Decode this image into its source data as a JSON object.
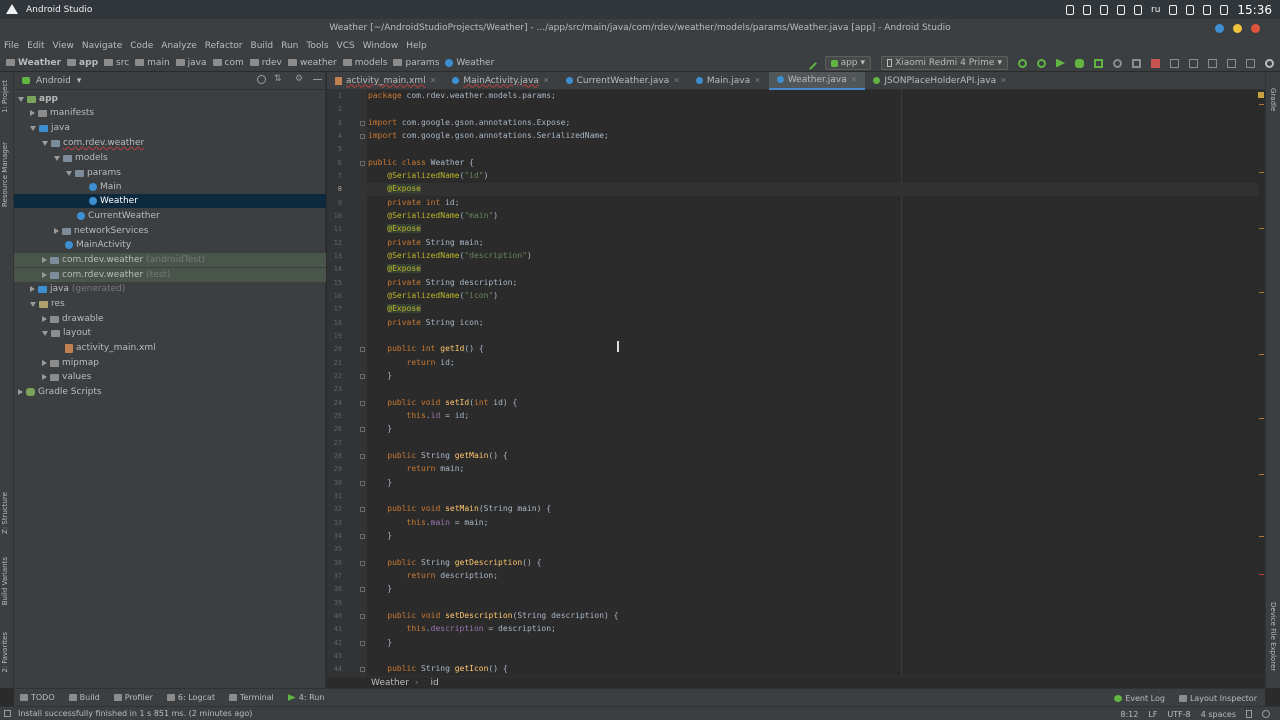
{
  "os_bar": {
    "app_name": "Android Studio",
    "keyboard_layout": "ru",
    "time": "15:36"
  },
  "window": {
    "title": "Weather [~/AndroidStudioProjects/Weather] - .../app/src/main/java/com/rdev/weather/models/params/Weather.java [app] - Android Studio"
  },
  "menu": [
    "File",
    "Edit",
    "View",
    "Navigate",
    "Code",
    "Analyze",
    "Refactor",
    "Build",
    "Run",
    "Tools",
    "VCS",
    "Window",
    "Help"
  ],
  "nav_bar": {
    "crumbs": [
      "Weather",
      "app",
      "src",
      "main",
      "java",
      "com",
      "rdev",
      "weather",
      "models",
      "params",
      "Weather"
    ],
    "run_config": "app",
    "device": "Xiaomi Redmi 4 Prime"
  },
  "side_labels": {
    "project": "1: Project",
    "resource_manager": "Resource Manager",
    "structure": "Z: Structure",
    "build_variants": "Build Variants",
    "favorites": "2: Favorites",
    "gradle": "Gradle",
    "device_file_explorer": "Device File Explorer"
  },
  "project_panel": {
    "view_mode": "Android",
    "tree": [
      {
        "label": "app",
        "suffix": "",
        "level": 0
      },
      {
        "label": "manifests",
        "suffix": "",
        "level": 1
      },
      {
        "label": "java",
        "suffix": "",
        "level": 1
      },
      {
        "label": "com.rdev.weather",
        "suffix": "",
        "level": 2
      },
      {
        "label": "models",
        "suffix": "",
        "level": 3
      },
      {
        "label": "params",
        "suffix": "",
        "level": 4
      },
      {
        "label": "Main",
        "suffix": "",
        "level": 5
      },
      {
        "label": "Weather",
        "suffix": "",
        "level": 5
      },
      {
        "label": "CurrentWeather",
        "suffix": "",
        "level": 4
      },
      {
        "label": "networkServices",
        "suffix": "",
        "level": 3
      },
      {
        "label": "MainActivity",
        "suffix": "",
        "level": 3
      },
      {
        "label": "com.rdev.weather",
        "suffix": "(androidTest)",
        "level": 2
      },
      {
        "label": "com.rdev.weather",
        "suffix": "(test)",
        "level": 2
      },
      {
        "label": "java",
        "suffix": "(generated)",
        "level": 1
      },
      {
        "label": "res",
        "suffix": "",
        "level": 1
      },
      {
        "label": "drawable",
        "suffix": "",
        "level": 2
      },
      {
        "label": "layout",
        "suffix": "",
        "level": 2
      },
      {
        "label": "activity_main.xml",
        "suffix": "",
        "level": 3
      },
      {
        "label": "mipmap",
        "suffix": "",
        "level": 2
      },
      {
        "label": "values",
        "suffix": "",
        "level": 2
      },
      {
        "label": "Gradle Scripts",
        "suffix": "",
        "level": 0
      }
    ]
  },
  "editor_tabs": [
    {
      "label": "activity_main.xml",
      "icon": "xml-file-icon"
    },
    {
      "label": "MainActivity.java",
      "icon": "class-icon"
    },
    {
      "label": "CurrentWeather.java",
      "icon": "class-icon"
    },
    {
      "label": "Main.java",
      "icon": "class-icon"
    },
    {
      "label": "Weather.java",
      "icon": "class-icon"
    },
    {
      "label": "JSONPlaceHolderAPI.java",
      "icon": "interface-icon"
    }
  ],
  "code": {
    "first_line_number": 1,
    "current_line": 8,
    "lines": [
      "package com.rdev.weather.models.params;",
      "",
      "import com.google.gson.annotations.Expose;",
      "import com.google.gson.annotations.SerializedName;",
      "",
      "public class Weather {",
      "    @SerializedName(\"id\")",
      "    @Expose",
      "    private int id;",
      "    @SerializedName(\"main\")",
      "    @Expose",
      "    private String main;",
      "    @SerializedName(\"description\")",
      "    @Expose",
      "    private String description;",
      "    @SerializedName(\"icon\")",
      "    @Expose",
      "    private String icon;",
      "",
      "    public int getId() {",
      "        return id;",
      "    }",
      "",
      "    public void setId(int id) {",
      "        this.id = id;",
      "    }",
      "",
      "    public String getMain() {",
      "        return main;",
      "    }",
      "",
      "    public void setMain(String main) {",
      "        this.main = main;",
      "    }",
      "",
      "    public String getDescription() {",
      "        return description;",
      "    }",
      "",
      "    public void setDescription(String description) {",
      "        this.description = description;",
      "    }",
      "",
      "    public String getIcon() {"
    ]
  },
  "editor_breadcrumb": [
    "Weather",
    "id"
  ],
  "tool_windows": [
    "TODO",
    "Build",
    "Profiler",
    "6: Logcat",
    "Terminal",
    "4: Run"
  ],
  "tool_windows_right": [
    "Event Log",
    "Layout Inspector"
  ],
  "status": {
    "message": "Install successfully finished in 1 s 851 ms. (2 minutes ago)",
    "position": "8:12",
    "line_separator": "LF",
    "encoding": "UTF-8",
    "indent": "4 spaces"
  }
}
